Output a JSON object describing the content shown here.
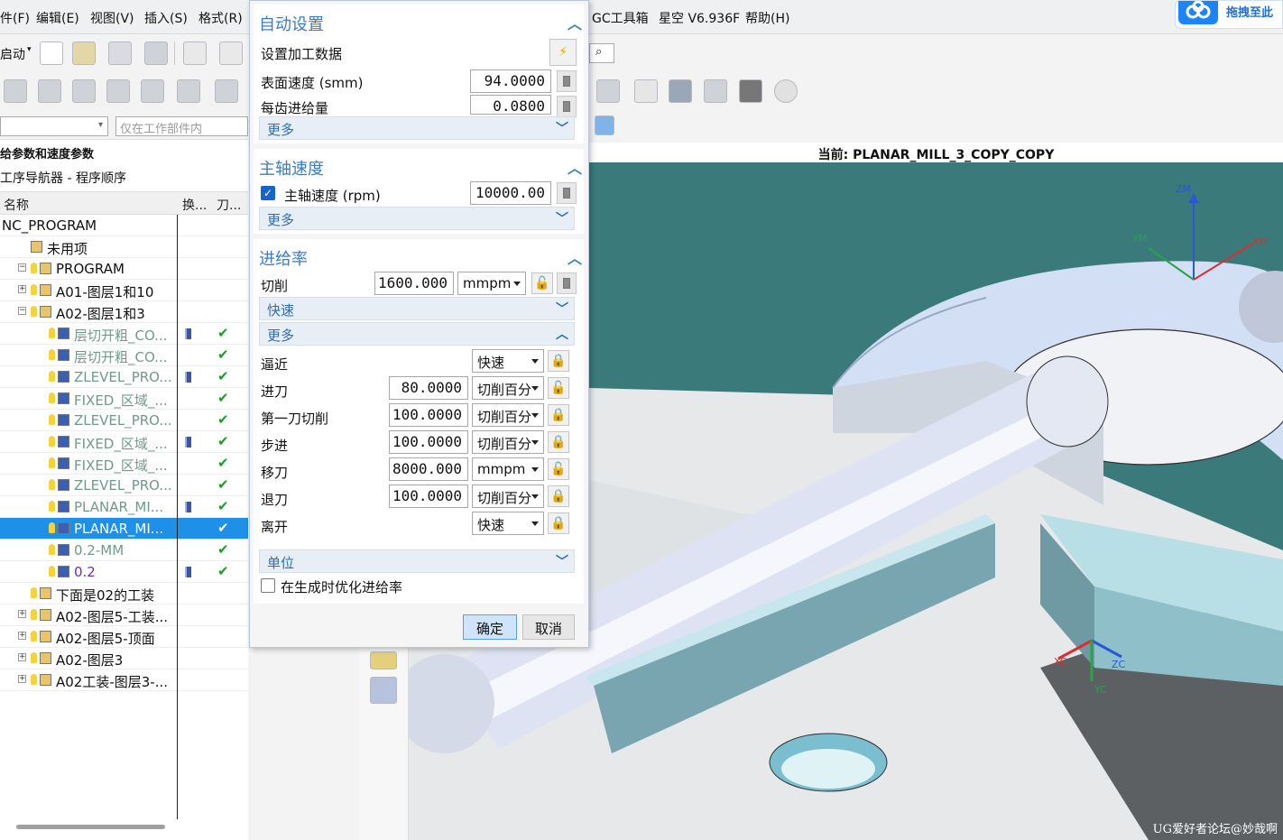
{
  "menubar": {
    "items": [
      "件(F)",
      "编辑(E)",
      "视图(V)",
      "插入(S)",
      "格式(R)",
      "GC工具箱",
      "星空 V6.936F",
      "帮助(H)"
    ],
    "cloud_label": "拖拽至此"
  },
  "toolbar": {
    "start_label": "启动",
    "filter_placeholder": "仅在工作部件内"
  },
  "navigator": {
    "group_title": "给参数和速度参数",
    "title": "工序导航器 - 程序顺序",
    "columns": [
      "名称",
      "换...",
      "刀..."
    ],
    "rows": [
      {
        "label": "NC_PROGRAM",
        "indent": 0,
        "style": "normal"
      },
      {
        "label": "未用项",
        "indent": 1,
        "style": "normal"
      },
      {
        "label": "PROGRAM",
        "indent": 1,
        "style": "normal",
        "expander": "−"
      },
      {
        "label": "A01-图层1和10",
        "indent": 2,
        "style": "normal",
        "expander": "+"
      },
      {
        "label": "A02-图层1和3",
        "indent": 2,
        "style": "normal",
        "expander": "−"
      },
      {
        "label": "层切开粗_CO...",
        "indent": 3,
        "style": "grey",
        "tool": true,
        "check": "✔"
      },
      {
        "label": "层切开粗_CO...",
        "indent": 3,
        "style": "grey",
        "check": "✔"
      },
      {
        "label": "ZLEVEL_PRO...",
        "indent": 3,
        "style": "grey",
        "tool": true,
        "check": "✔"
      },
      {
        "label": "FIXED_区域_...",
        "indent": 3,
        "style": "grey",
        "check": "✔"
      },
      {
        "label": "ZLEVEL_PRO...",
        "indent": 3,
        "style": "grey",
        "check": "✔"
      },
      {
        "label": "FIXED_区域_...",
        "indent": 3,
        "style": "grey",
        "tool": true,
        "check": "✔"
      },
      {
        "label": "FIXED_区域_...",
        "indent": 3,
        "style": "grey",
        "check": "✔"
      },
      {
        "label": "ZLEVEL_PRO...",
        "indent": 3,
        "style": "grey",
        "check": "✔"
      },
      {
        "label": "PLANAR_MI...",
        "indent": 3,
        "style": "grey",
        "tool": true,
        "check": "✔"
      },
      {
        "label": "PLANAR_MI...",
        "indent": 3,
        "style": "selected",
        "check": "✔"
      },
      {
        "label": "0.2-MM",
        "indent": 3,
        "style": "grey",
        "check": "✔"
      },
      {
        "label": "0.2",
        "indent": 3,
        "style": "purple",
        "tool": true,
        "check": "✔"
      },
      {
        "label": "下面是02的工装",
        "indent": 2,
        "style": "normal"
      },
      {
        "label": "A02-图层5-工装...",
        "indent": 2,
        "style": "normal",
        "expander": "+"
      },
      {
        "label": "A02-图层5-顶面",
        "indent": 2,
        "style": "normal",
        "expander": "+"
      },
      {
        "label": "A02-图层3",
        "indent": 2,
        "style": "normal",
        "expander": "+"
      },
      {
        "label": "A02工装-图层3-...",
        "indent": 2,
        "style": "normal",
        "expander": "+"
      }
    ]
  },
  "viewport": {
    "current_label": "当前:  PLANAR_MILL_3_COPY_COPY",
    "axes": {
      "zm": "ZM",
      "xm": "XM",
      "ym": "YM",
      "xc": "XC",
      "yc": "YC",
      "zc": "ZC"
    },
    "watermark": "UG爱好者论坛@妙哉啊"
  },
  "dialog": {
    "auto": {
      "title": "自动设置",
      "set_data_label": "设置加工数据",
      "surface_speed_label": "表面速度 (smm)",
      "surface_speed_value": "94.0000",
      "feed_per_tooth_label": "每齿进给量",
      "feed_per_tooth_value": "0.0800",
      "more_label": "更多"
    },
    "spindle": {
      "title": "主轴速度",
      "speed_label": "主轴速度 (rpm)",
      "speed_value": "10000.00",
      "more_label": "更多"
    },
    "feed": {
      "title": "进给率",
      "cut_label": "切削",
      "cut_value": "1600.000",
      "cut_unit": "mmpm",
      "rapid_label": "快速",
      "more_label": "更多",
      "rows": [
        {
          "label": "逼近",
          "value": "",
          "unit": "快速"
        },
        {
          "label": "进刀",
          "value": "80.0000",
          "unit": "切削百分"
        },
        {
          "label": "第一刀切削",
          "value": "100.0000",
          "unit": "切削百分"
        },
        {
          "label": "步进",
          "value": "100.0000",
          "unit": "切削百分"
        },
        {
          "label": "移刀",
          "value": "8000.000",
          "unit": "mmpm"
        },
        {
          "label": "退刀",
          "value": "100.0000",
          "unit": "切削百分"
        },
        {
          "label": "离开",
          "value": "",
          "unit": "快速"
        }
      ],
      "units_label": "单位",
      "optimize_label": "在生成时优化进给率"
    },
    "ok_label": "确定",
    "cancel_label": "取消"
  },
  "colors": {
    "accent": "#3b7dc4",
    "selection": "#1e90e8",
    "check": "#1d9a2a",
    "viewport_bg": "#3a7a7a"
  }
}
